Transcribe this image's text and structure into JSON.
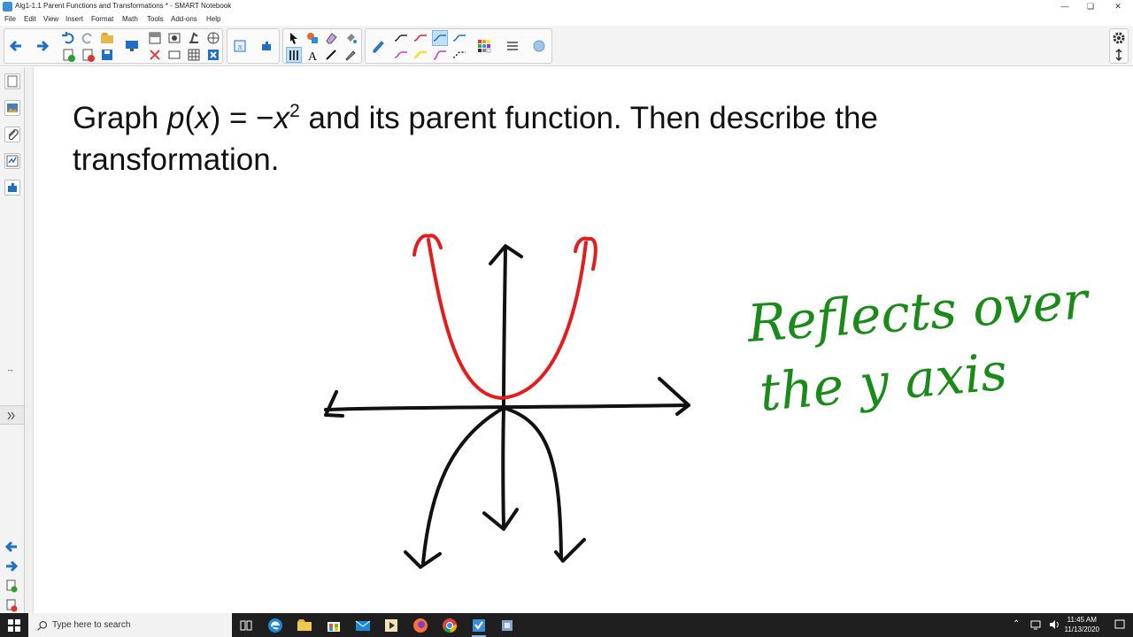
{
  "window": {
    "title": "Alg1-1.1 Parent Functions and Transformations * - SMART Notebook",
    "minimize_icon": "minimize-icon",
    "maximize_icon": "restore-icon",
    "close_icon": "close-icon"
  },
  "menu": [
    "File",
    "Edit",
    "View",
    "Insert",
    "Format",
    "Math",
    "Tools",
    "Add-ons",
    "Help"
  ],
  "toolbar": {
    "tools": [
      "back",
      "forward",
      "undo",
      "redo",
      "open",
      "add-page",
      "delete-page",
      "save",
      "screen-shade",
      "screen-capture",
      "table",
      "math",
      "add-ons",
      "select",
      "pens",
      "eraser",
      "fill",
      "text",
      "lines",
      "shapes",
      "magic-pen",
      "colors",
      "properties"
    ],
    "selected_pen": "pen-style-3",
    "settings_icon": "gear-icon",
    "move_toolbar_icon": "move-toolbar-icon"
  },
  "sidebar": {
    "tabs": [
      "page-sorter-icon",
      "gallery-icon",
      "attachments-icon",
      "properties-icon",
      "add-ons-icon"
    ],
    "collapse_icon": "resize-icon",
    "expand_icon": "expand-icon"
  },
  "question": {
    "text_before": "Graph ",
    "func_name": "p",
    "open_paren": "(",
    "var": "x",
    "equals": ") = −",
    "var2": "x",
    "exponent": "2",
    "text_after": " and its parent function. Then describe the transformation."
  },
  "annotation": {
    "line1": "Reflects over",
    "line2": "the y axis"
  },
  "colors": {
    "red_curve": "#e11d1d",
    "black_ink": "#111111",
    "green_ink": "#1a8a1a",
    "taskbar": "#1f1f1f"
  },
  "taskbar": {
    "search_placeholder": "Type here to search",
    "time": "11:45 AM",
    "date": "11/13/2020",
    "apps": [
      "task-view-icon",
      "edge-icon",
      "file-explorer-icon",
      "store-icon",
      "mail-icon",
      "media-icon",
      "firefox-icon",
      "chrome-icon",
      "smart-notebook-icon",
      "app-icon"
    ]
  }
}
